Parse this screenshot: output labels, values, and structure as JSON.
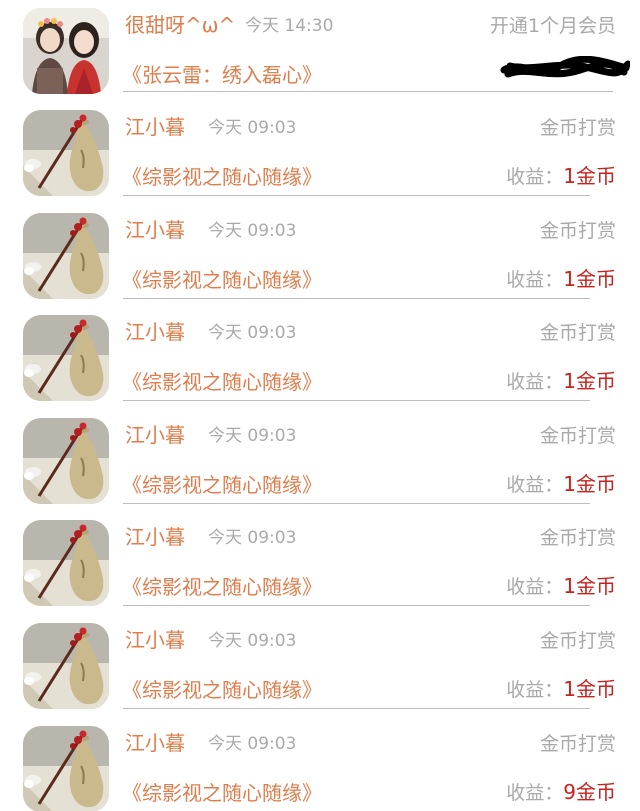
{
  "first": {
    "name": "很甜呀^ω^",
    "time": "今天 14:30",
    "type": "开通1个月会员",
    "title": "《张云雷：绣入磊心》",
    "avatar_icon": "two-girls-photo-avatar"
  },
  "rows": [
    {
      "name": "江小暮",
      "time": "今天 09:03",
      "type": "金币打赏",
      "title": "《综影视之随心随缘》",
      "income_label": "收益：",
      "income_amount": "1金币",
      "avatar_icon": "hairpin-vase-photo-avatar"
    },
    {
      "name": "江小暮",
      "time": "今天 09:03",
      "type": "金币打赏",
      "title": "《综影视之随心随缘》",
      "income_label": "收益：",
      "income_amount": "1金币",
      "avatar_icon": "hairpin-vase-photo-avatar"
    },
    {
      "name": "江小暮",
      "time": "今天 09:03",
      "type": "金币打赏",
      "title": "《综影视之随心随缘》",
      "income_label": "收益：",
      "income_amount": "1金币",
      "avatar_icon": "hairpin-vase-photo-avatar"
    },
    {
      "name": "江小暮",
      "time": "今天 09:03",
      "type": "金币打赏",
      "title": "《综影视之随心随缘》",
      "income_label": "收益：",
      "income_amount": "1金币",
      "avatar_icon": "hairpin-vase-photo-avatar"
    },
    {
      "name": "江小暮",
      "time": "今天 09:03",
      "type": "金币打赏",
      "title": "《综影视之随心随缘》",
      "income_label": "收益：",
      "income_amount": "1金币",
      "avatar_icon": "hairpin-vase-photo-avatar"
    },
    {
      "name": "江小暮",
      "time": "今天 09:03",
      "type": "金币打赏",
      "title": "《综影视之随心随缘》",
      "income_label": "收益：",
      "income_amount": "1金币",
      "avatar_icon": "hairpin-vase-photo-avatar"
    },
    {
      "name": "江小暮",
      "time": "今天 09:03",
      "type": "金币打赏",
      "title": "《综影视之随心随缘》",
      "income_label": "收益：",
      "income_amount": "9金币",
      "avatar_icon": "hairpin-vase-photo-avatar"
    }
  ],
  "colors": {
    "name": "#e07d4c",
    "amount": "#c6221e",
    "muted": "#a9a9a9",
    "divider": "#bdbdbd"
  }
}
